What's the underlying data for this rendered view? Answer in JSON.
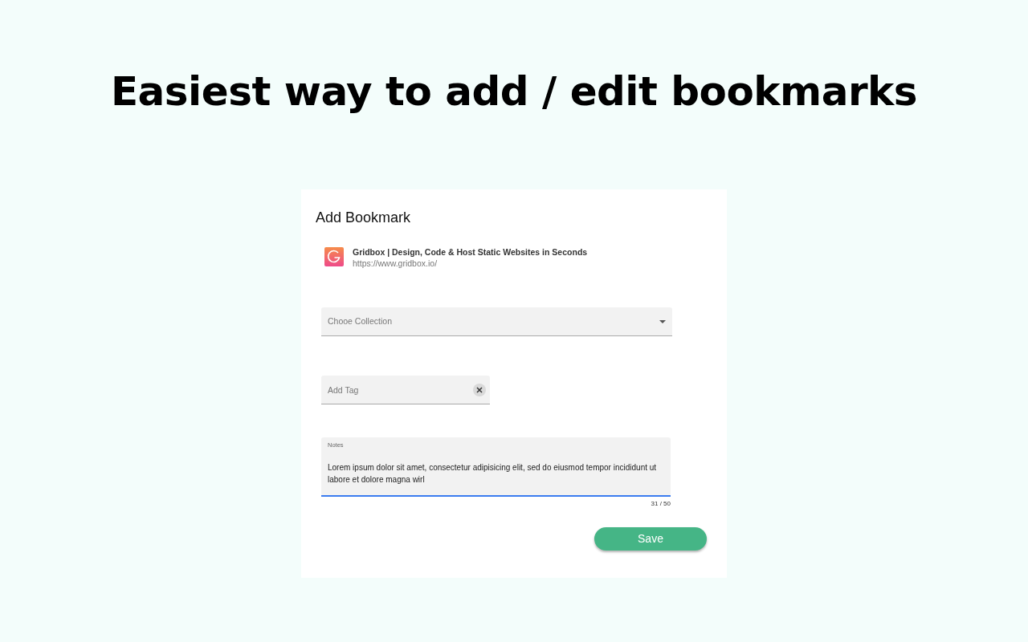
{
  "headline": "Easiest way to add / edit bookmarks",
  "dialog": {
    "title": "Add Bookmark",
    "site": {
      "title": "Gridbox | Design, Code & Host Static Websites in Seconds",
      "url": "https://www.gridbox.io/"
    },
    "collection": {
      "placeholder": "Chooe Collection"
    },
    "tag": {
      "placeholder": "Add Tag"
    },
    "notes": {
      "label": "Notes",
      "value": "Lorem ipsum dolor sit amet, consectetur adipisicing elit, sed do eiusmod tempor incididunt ut labore et dolore magna wirl",
      "focused": true,
      "counter": "31 / 50"
    },
    "save": "Save"
  }
}
